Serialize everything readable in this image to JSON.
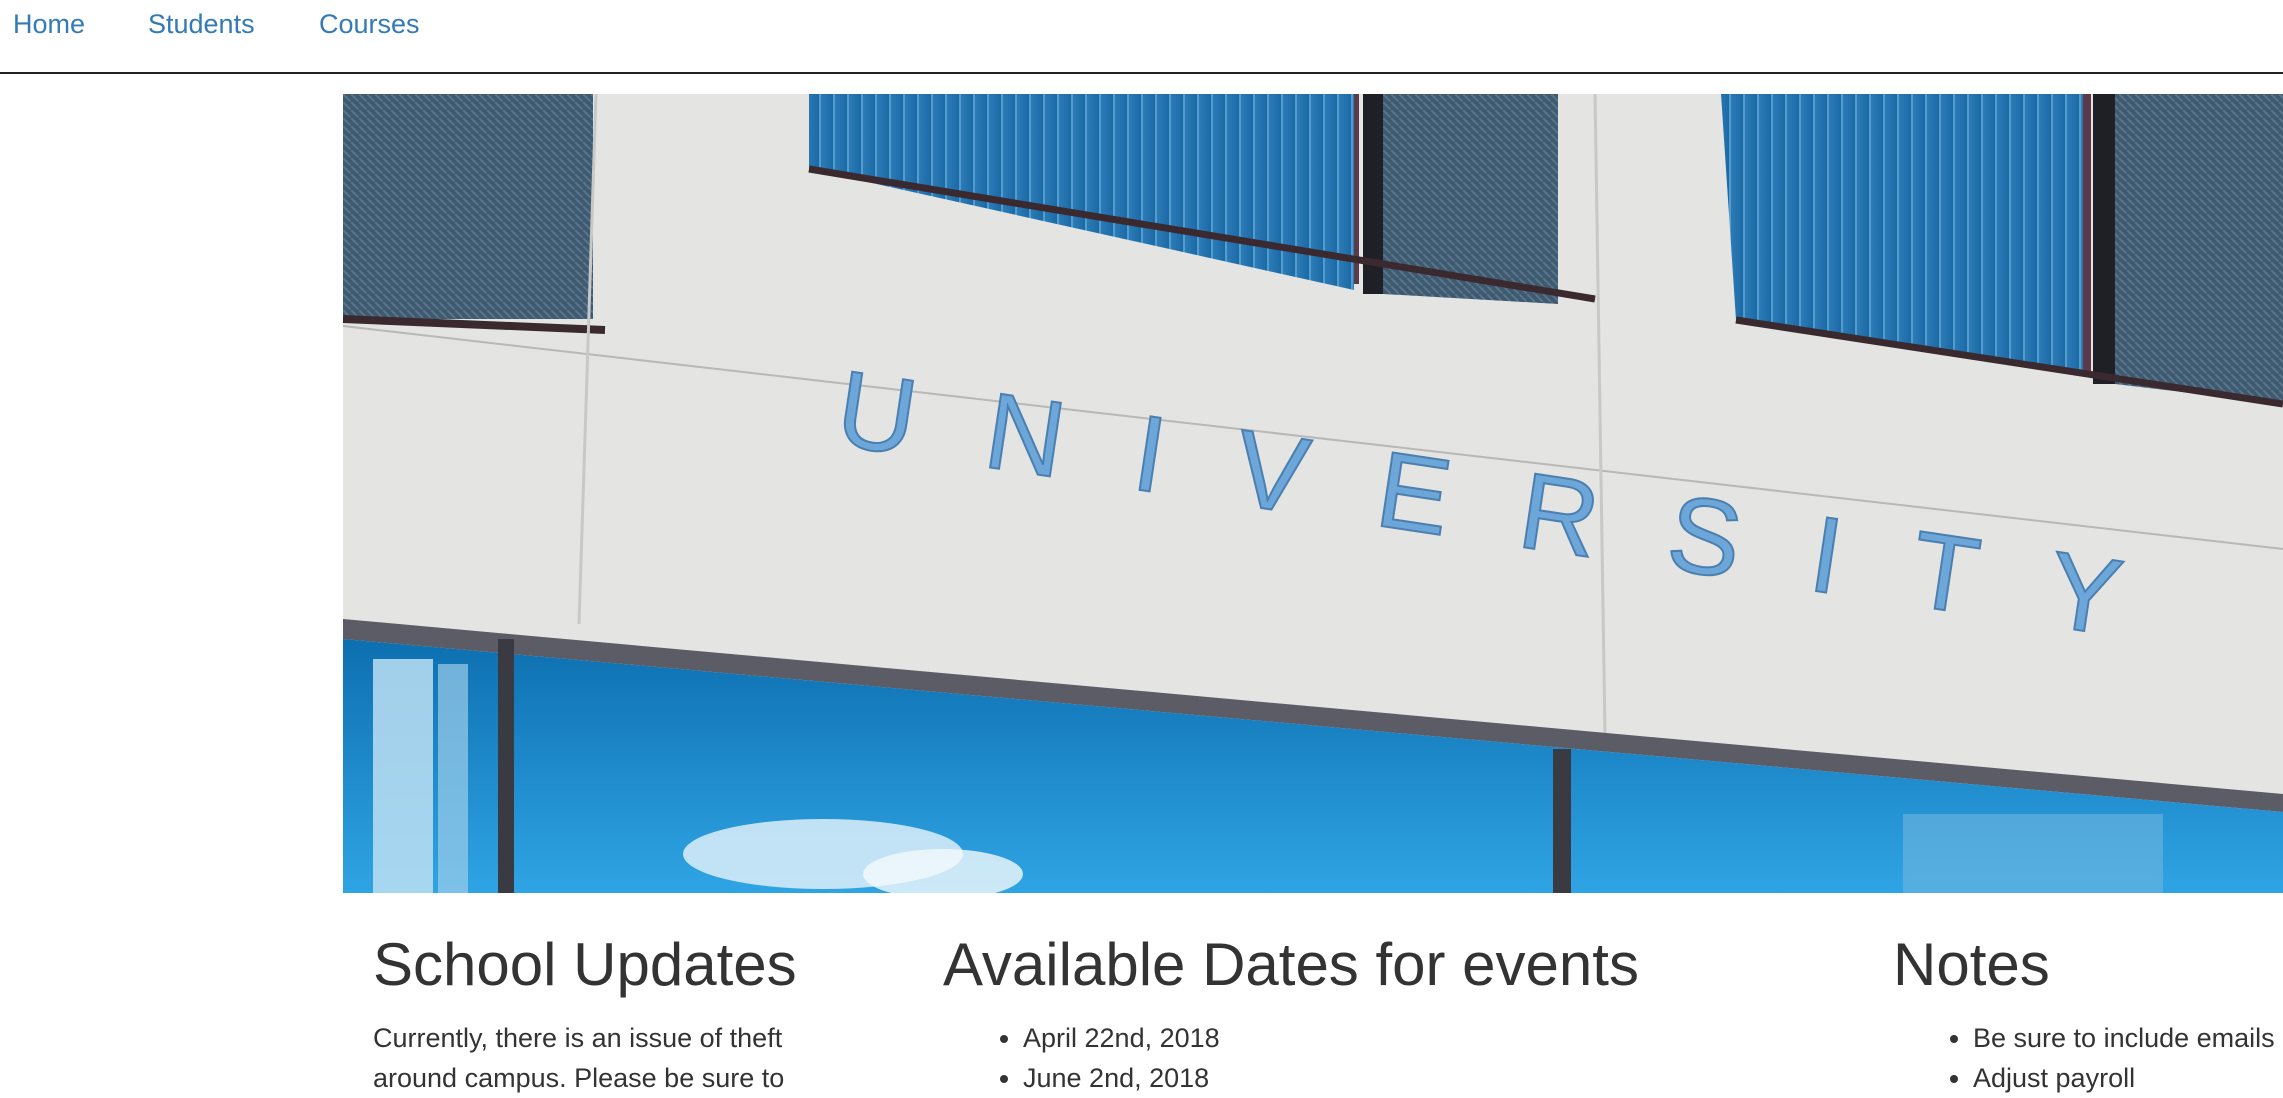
{
  "nav": {
    "home": "Home",
    "students": "Students",
    "courses": "Courses"
  },
  "hero": {
    "sign_text": "UNIVERSITY",
    "colors": {
      "facade": "#e6e6e4",
      "window_blue": "#1b86c8",
      "blind_dark": "#3d5566",
      "frame": "#2a2a30"
    }
  },
  "updates": {
    "title": "School Updates",
    "text": "Currently, there is an issue of theft around campus. Please be sure to"
  },
  "dates": {
    "title": "Available Dates for events",
    "items": [
      "April 22nd, 2018",
      "June 2nd, 2018"
    ]
  },
  "notes": {
    "title": "Notes",
    "items": [
      "Be sure to include emails",
      "Adjust payroll"
    ]
  }
}
